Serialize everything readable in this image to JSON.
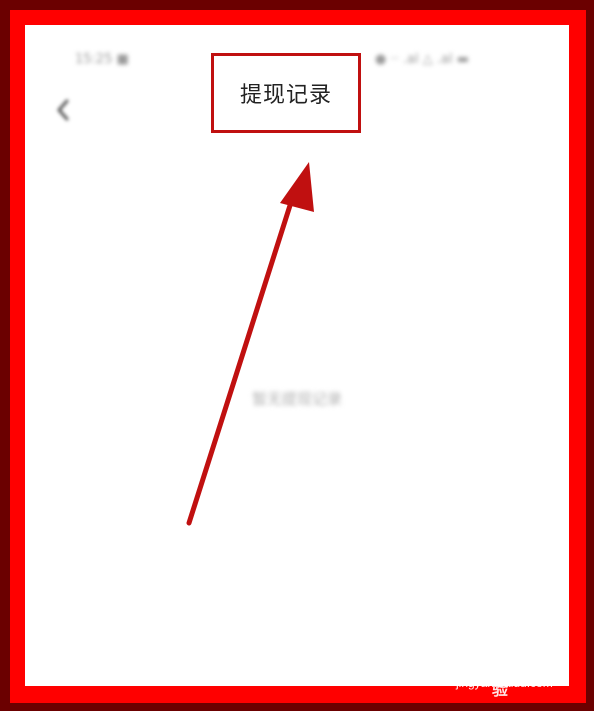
{
  "status_bar": {
    "time": "15:25 ■",
    "right": "● ·‧ .al △ .al ▬"
  },
  "header": {
    "back_icon": "chevron-left-icon",
    "title": "提现记录"
  },
  "main": {
    "empty_state": "暂无提现记录"
  },
  "annotation": {
    "box_color": "#c01010",
    "arrow_color": "#c01010"
  },
  "watermark": {
    "brand": "Bai●u 经验",
    "url": "jingyan.baidu.com"
  },
  "colors": {
    "frame_outer": "#6b0000",
    "frame_inner": "#ff0000",
    "background": "#ffffff"
  }
}
